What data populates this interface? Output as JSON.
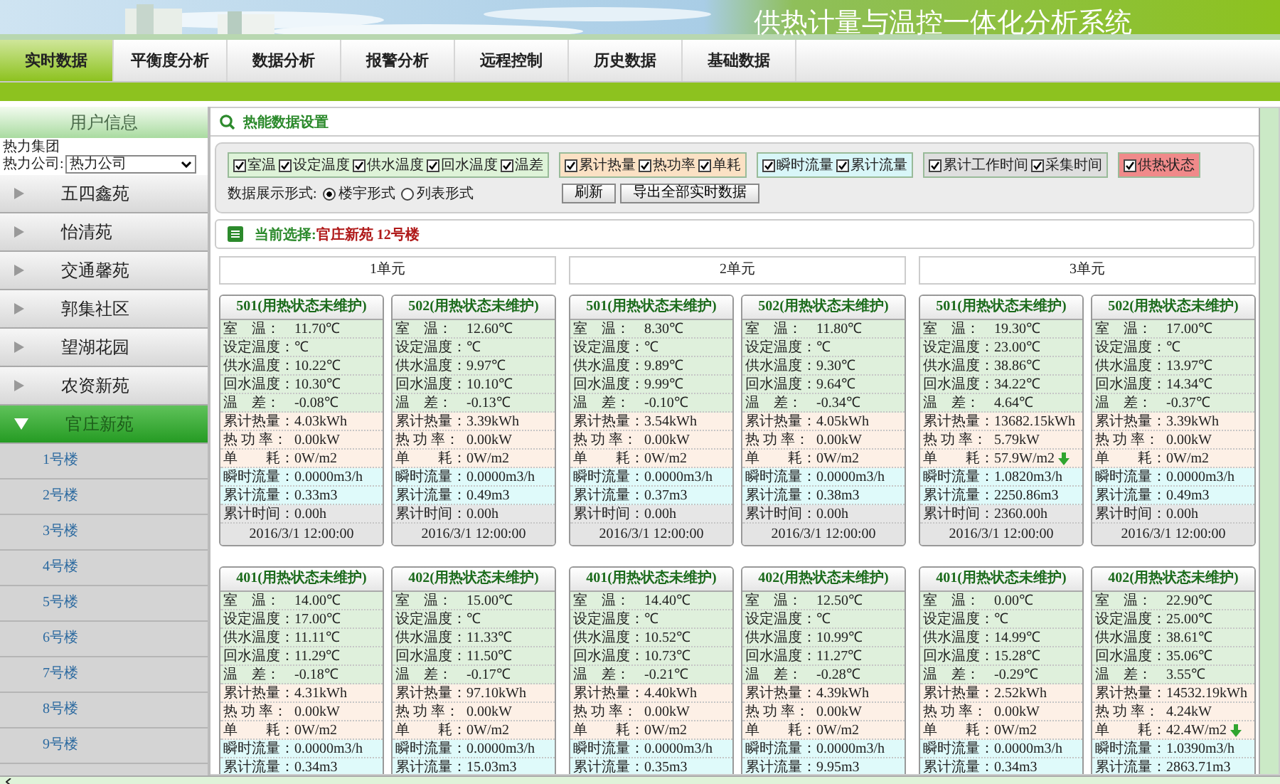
{
  "header": {
    "title": "供热计量与温控一体化分析系统"
  },
  "tabs": [
    {
      "label": "实时数据",
      "selected": true
    },
    {
      "label": "平衡度分析",
      "selected": false
    },
    {
      "label": "数据分析",
      "selected": false
    },
    {
      "label": "报警分析",
      "selected": false
    },
    {
      "label": "远程控制",
      "selected": false
    },
    {
      "label": "历史数据",
      "selected": false
    },
    {
      "label": "基础数据",
      "selected": false
    }
  ],
  "sidebar": {
    "title": "用户信息",
    "group": "热力集团",
    "company_label": "热力公司:",
    "company_value": "热力公司",
    "items": [
      {
        "label": "五四鑫苑",
        "expanded": false,
        "selected": false
      },
      {
        "label": "怡清苑",
        "expanded": false,
        "selected": false
      },
      {
        "label": "交通馨苑",
        "expanded": false,
        "selected": false
      },
      {
        "label": "郭集社区",
        "expanded": false,
        "selected": false
      },
      {
        "label": "望湖花园",
        "expanded": false,
        "selected": false
      },
      {
        "label": "农资新苑",
        "expanded": false,
        "selected": false
      },
      {
        "label": "官庄新苑",
        "expanded": true,
        "selected": true,
        "children": [
          {
            "label": "1号楼",
            "selected": false
          },
          {
            "label": "2号楼",
            "selected": false
          },
          {
            "label": "3号楼",
            "selected": false
          },
          {
            "label": "4号楼",
            "selected": false
          },
          {
            "label": "5号楼",
            "selected": false
          },
          {
            "label": "6号楼",
            "selected": false
          },
          {
            "label": "7号楼",
            "selected": false
          },
          {
            "label": "8号楼",
            "selected": false
          },
          {
            "label": "9号楼",
            "selected": false
          }
        ]
      }
    ]
  },
  "settings": {
    "title": "热能数据设置",
    "groups": [
      {
        "color": "#def3d8",
        "items": [
          {
            "label": "室温",
            "checked": true
          },
          {
            "label": "设定温度",
            "checked": true
          },
          {
            "label": "供水温度",
            "checked": true
          },
          {
            "label": "回水温度",
            "checked": true
          },
          {
            "label": "温差",
            "checked": true
          }
        ]
      },
      {
        "color": "#fbe1c4",
        "items": [
          {
            "label": "累计热量",
            "checked": true
          },
          {
            "label": "热功率",
            "checked": true
          },
          {
            "label": "单耗",
            "checked": true
          }
        ]
      },
      {
        "color": "#d8f6f8",
        "items": [
          {
            "label": "瞬时流量",
            "checked": true
          },
          {
            "label": "累计流量",
            "checked": true
          }
        ]
      },
      {
        "color": "#dedede",
        "items": [
          {
            "label": "累计工作时间",
            "checked": true
          },
          {
            "label": "采集时间",
            "checked": true
          }
        ]
      },
      {
        "color": "#f08a8a",
        "items": [
          {
            "label": "供热状态",
            "checked": true
          }
        ]
      }
    ],
    "display_label": "数据展示形式:",
    "display_options": [
      {
        "label": "楼宇形式",
        "selected": true
      },
      {
        "label": "列表形式",
        "selected": false
      }
    ],
    "buttons": [
      "刷新",
      "导出全部实时数据"
    ]
  },
  "current": {
    "label": "当前选择:",
    "value": "官庄新苑 12号楼"
  },
  "units": [
    {
      "title": "1单元",
      "cards": [
        {
          "title": "501(用热状态未维护)",
          "time": "2016/3/1 12:00:00",
          "rows": [
            {
              "label": "室　温：",
              "value": "11.70℃",
              "kind": "temp"
            },
            {
              "label": "设定温度：",
              "value": "℃",
              "kind": "temp"
            },
            {
              "label": "供水温度：",
              "value": "10.22℃",
              "kind": "temp"
            },
            {
              "label": "回水温度：",
              "value": "10.30℃",
              "kind": "temp"
            },
            {
              "label": "温　差：",
              "value": "-0.08℃",
              "kind": "temp"
            },
            {
              "label": "累计热量：",
              "value": "4.03kWh",
              "kind": "heat"
            },
            {
              "label": "热 功 率：",
              "value": "0.00kW",
              "kind": "heat"
            },
            {
              "label": "单　　耗：",
              "value": "0W/m2",
              "kind": "heat"
            },
            {
              "label": "瞬时流量：",
              "value": "0.0000m3/h",
              "kind": "flow"
            },
            {
              "label": "累计流量：",
              "value": "0.33m3",
              "kind": "flow"
            },
            {
              "label": "累计时间：",
              "value": "0.00h",
              "kind": "time"
            }
          ]
        },
        {
          "title": "502(用热状态未维护)",
          "time": "2016/3/1 12:00:00",
          "rows": [
            {
              "label": "室　温：",
              "value": "12.60℃",
              "kind": "temp"
            },
            {
              "label": "设定温度：",
              "value": "℃",
              "kind": "temp"
            },
            {
              "label": "供水温度：",
              "value": "9.97℃",
              "kind": "temp"
            },
            {
              "label": "回水温度：",
              "value": "10.10℃",
              "kind": "temp"
            },
            {
              "label": "温　差：",
              "value": "-0.13℃",
              "kind": "temp"
            },
            {
              "label": "累计热量：",
              "value": "3.39kWh",
              "kind": "heat"
            },
            {
              "label": "热 功 率：",
              "value": "0.00kW",
              "kind": "heat"
            },
            {
              "label": "单　　耗：",
              "value": "0W/m2",
              "kind": "heat"
            },
            {
              "label": "瞬时流量：",
              "value": "0.0000m3/h",
              "kind": "flow"
            },
            {
              "label": "累计流量：",
              "value": "0.49m3",
              "kind": "flow"
            },
            {
              "label": "累计时间：",
              "value": "0.00h",
              "kind": "time"
            }
          ]
        },
        {
          "title": "401(用热状态未维护)",
          "rows": [
            {
              "label": "室　温：",
              "value": "14.00℃",
              "kind": "temp"
            },
            {
              "label": "设定温度：",
              "value": "17.00℃",
              "kind": "temp"
            },
            {
              "label": "供水温度：",
              "value": "11.11℃",
              "kind": "temp"
            },
            {
              "label": "回水温度：",
              "value": "11.29℃",
              "kind": "temp"
            },
            {
              "label": "温　差：",
              "value": "-0.18℃",
              "kind": "temp"
            },
            {
              "label": "累计热量：",
              "value": "4.31kWh",
              "kind": "heat"
            },
            {
              "label": "热 功 率：",
              "value": "0.00kW",
              "kind": "heat"
            },
            {
              "label": "单　　耗：",
              "value": "0W/m2",
              "kind": "heat"
            },
            {
              "label": "瞬时流量：",
              "value": "0.0000m3/h",
              "kind": "flow"
            },
            {
              "label": "累计流量：",
              "value": "0.34m3",
              "kind": "flow"
            }
          ]
        },
        {
          "title": "402(用热状态未维护)",
          "rows": [
            {
              "label": "室　温：",
              "value": "15.00℃",
              "kind": "temp"
            },
            {
              "label": "设定温度：",
              "value": "℃",
              "kind": "temp"
            },
            {
              "label": "供水温度：",
              "value": "11.33℃",
              "kind": "temp"
            },
            {
              "label": "回水温度：",
              "value": "11.50℃",
              "kind": "temp"
            },
            {
              "label": "温　差：",
              "value": "-0.17℃",
              "kind": "temp"
            },
            {
              "label": "累计热量：",
              "value": "97.10kWh",
              "kind": "heat"
            },
            {
              "label": "热 功 率：",
              "value": "0.00kW",
              "kind": "heat"
            },
            {
              "label": "单　　耗：",
              "value": "0W/m2",
              "kind": "heat"
            },
            {
              "label": "瞬时流量：",
              "value": "0.0000m3/h",
              "kind": "flow"
            },
            {
              "label": "累计流量：",
              "value": "15.03m3",
              "kind": "flow"
            }
          ]
        }
      ]
    },
    {
      "title": "2单元",
      "cards": [
        {
          "title": "501(用热状态未维护)",
          "time": "2016/3/1 12:00:00",
          "rows": [
            {
              "label": "室　温：",
              "value": "8.30℃",
              "kind": "temp"
            },
            {
              "label": "设定温度：",
              "value": "℃",
              "kind": "temp"
            },
            {
              "label": "供水温度：",
              "value": "9.89℃",
              "kind": "temp"
            },
            {
              "label": "回水温度：",
              "value": "9.99℃",
              "kind": "temp"
            },
            {
              "label": "温　差：",
              "value": "-0.10℃",
              "kind": "temp"
            },
            {
              "label": "累计热量：",
              "value": "3.54kWh",
              "kind": "heat"
            },
            {
              "label": "热 功 率：",
              "value": "0.00kW",
              "kind": "heat"
            },
            {
              "label": "单　　耗：",
              "value": "0W/m2",
              "kind": "heat"
            },
            {
              "label": "瞬时流量：",
              "value": "0.0000m3/h",
              "kind": "flow"
            },
            {
              "label": "累计流量：",
              "value": "0.37m3",
              "kind": "flow"
            },
            {
              "label": "累计时间：",
              "value": "0.00h",
              "kind": "time"
            }
          ]
        },
        {
          "title": "502(用热状态未维护)",
          "time": "2016/3/1 12:00:00",
          "rows": [
            {
              "label": "室　温：",
              "value": "11.80℃",
              "kind": "temp"
            },
            {
              "label": "设定温度：",
              "value": "℃",
              "kind": "temp"
            },
            {
              "label": "供水温度：",
              "value": "9.30℃",
              "kind": "temp"
            },
            {
              "label": "回水温度：",
              "value": "9.64℃",
              "kind": "temp"
            },
            {
              "label": "温　差：",
              "value": "-0.34℃",
              "kind": "temp"
            },
            {
              "label": "累计热量：",
              "value": "4.05kWh",
              "kind": "heat"
            },
            {
              "label": "热 功 率：",
              "value": "0.00kW",
              "kind": "heat"
            },
            {
              "label": "单　　耗：",
              "value": "0W/m2",
              "kind": "heat"
            },
            {
              "label": "瞬时流量：",
              "value": "0.0000m3/h",
              "kind": "flow"
            },
            {
              "label": "累计流量：",
              "value": "0.38m3",
              "kind": "flow"
            },
            {
              "label": "累计时间：",
              "value": "0.00h",
              "kind": "time"
            }
          ]
        },
        {
          "title": "401(用热状态未维护)",
          "rows": [
            {
              "label": "室　温：",
              "value": "14.40℃",
              "kind": "temp"
            },
            {
              "label": "设定温度：",
              "value": "℃",
              "kind": "temp"
            },
            {
              "label": "供水温度：",
              "value": "10.52℃",
              "kind": "temp"
            },
            {
              "label": "回水温度：",
              "value": "10.73℃",
              "kind": "temp"
            },
            {
              "label": "温　差：",
              "value": "-0.21℃",
              "kind": "temp"
            },
            {
              "label": "累计热量：",
              "value": "4.40kWh",
              "kind": "heat"
            },
            {
              "label": "热 功 率：",
              "value": "0.00kW",
              "kind": "heat"
            },
            {
              "label": "单　　耗：",
              "value": "0W/m2",
              "kind": "heat"
            },
            {
              "label": "瞬时流量：",
              "value": "0.0000m3/h",
              "kind": "flow"
            },
            {
              "label": "累计流量：",
              "value": "0.35m3",
              "kind": "flow"
            }
          ]
        },
        {
          "title": "402(用热状态未维护)",
          "rows": [
            {
              "label": "室　温：",
              "value": "12.50℃",
              "kind": "temp"
            },
            {
              "label": "设定温度：",
              "value": "℃",
              "kind": "temp"
            },
            {
              "label": "供水温度：",
              "value": "10.99℃",
              "kind": "temp"
            },
            {
              "label": "回水温度：",
              "value": "11.27℃",
              "kind": "temp"
            },
            {
              "label": "温　差：",
              "value": "-0.28℃",
              "kind": "temp"
            },
            {
              "label": "累计热量：",
              "value": "4.39kWh",
              "kind": "heat"
            },
            {
              "label": "热 功 率：",
              "value": "0.00kW",
              "kind": "heat"
            },
            {
              "label": "单　　耗：",
              "value": "0W/m2",
              "kind": "heat"
            },
            {
              "label": "瞬时流量：",
              "value": "0.0000m3/h",
              "kind": "flow"
            },
            {
              "label": "累计流量：",
              "value": "9.95m3",
              "kind": "flow"
            }
          ]
        }
      ]
    },
    {
      "title": "3单元",
      "cards": [
        {
          "title": "501(用热状态未维护)",
          "time": "2016/3/1 12:00:00",
          "rows": [
            {
              "label": "室　温：",
              "value": "19.30℃",
              "kind": "temp"
            },
            {
              "label": "设定温度：",
              "value": "23.00℃",
              "kind": "temp"
            },
            {
              "label": "供水温度：",
              "value": "38.86℃",
              "kind": "temp"
            },
            {
              "label": "回水温度：",
              "value": "34.22℃",
              "kind": "temp"
            },
            {
              "label": "温　差：",
              "value": "4.64℃",
              "kind": "temp"
            },
            {
              "label": "累计热量：",
              "value": "13682.15kWh",
              "kind": "heat"
            },
            {
              "label": "热 功 率：",
              "value": "5.79kW",
              "kind": "heat"
            },
            {
              "label": "单　　耗：",
              "value": "57.9W/m2",
              "kind": "heat",
              "falling": true
            },
            {
              "label": "瞬时流量：",
              "value": "1.0820m3/h",
              "kind": "flow"
            },
            {
              "label": "累计流量：",
              "value": "2250.86m3",
              "kind": "flow"
            },
            {
              "label": "累计时间：",
              "value": "2360.00h",
              "kind": "time"
            }
          ]
        },
        {
          "title": "502(用热状态未维护)",
          "time": "2016/3/1 12:00:00",
          "rows": [
            {
              "label": "室　温：",
              "value": "17.00℃",
              "kind": "temp"
            },
            {
              "label": "设定温度：",
              "value": "℃",
              "kind": "temp"
            },
            {
              "label": "供水温度：",
              "value": "13.97℃",
              "kind": "temp"
            },
            {
              "label": "回水温度：",
              "value": "14.34℃",
              "kind": "temp"
            },
            {
              "label": "温　差：",
              "value": "-0.37℃",
              "kind": "temp"
            },
            {
              "label": "累计热量：",
              "value": "3.39kWh",
              "kind": "heat"
            },
            {
              "label": "热 功 率：",
              "value": "0.00kW",
              "kind": "heat"
            },
            {
              "label": "单　　耗：",
              "value": "0W/m2",
              "kind": "heat"
            },
            {
              "label": "瞬时流量：",
              "value": "0.0000m3/h",
              "kind": "flow"
            },
            {
              "label": "累计流量：",
              "value": "0.49m3",
              "kind": "flow"
            },
            {
              "label": "累计时间：",
              "value": "0.00h",
              "kind": "time"
            }
          ]
        },
        {
          "title": "401(用热状态未维护)",
          "rows": [
            {
              "label": "室　温：",
              "value": "0.00℃",
              "kind": "temp"
            },
            {
              "label": "设定温度：",
              "value": "℃",
              "kind": "temp"
            },
            {
              "label": "供水温度：",
              "value": "14.99℃",
              "kind": "temp"
            },
            {
              "label": "回水温度：",
              "value": "15.28℃",
              "kind": "temp"
            },
            {
              "label": "温　差：",
              "value": "-0.29℃",
              "kind": "temp"
            },
            {
              "label": "累计热量：",
              "value": "2.52kWh",
              "kind": "heat"
            },
            {
              "label": "热 功 率：",
              "value": "0.00kW",
              "kind": "heat"
            },
            {
              "label": "单　　耗：",
              "value": "0W/m2",
              "kind": "heat"
            },
            {
              "label": "瞬时流量：",
              "value": "0.0000m3/h",
              "kind": "flow"
            },
            {
              "label": "累计流量：",
              "value": "0.34m3",
              "kind": "flow"
            }
          ]
        },
        {
          "title": "402(用热状态未维护)",
          "rows": [
            {
              "label": "室　温：",
              "value": "22.90℃",
              "kind": "temp"
            },
            {
              "label": "设定温度：",
              "value": "25.00℃",
              "kind": "temp"
            },
            {
              "label": "供水温度：",
              "value": "38.61℃",
              "kind": "temp"
            },
            {
              "label": "回水温度：",
              "value": "35.06℃",
              "kind": "temp"
            },
            {
              "label": "温　差：",
              "value": "3.55℃",
              "kind": "temp"
            },
            {
              "label": "累计热量：",
              "value": "14532.19kWh",
              "kind": "heat"
            },
            {
              "label": "热 功 率：",
              "value": "4.24kW",
              "kind": "heat"
            },
            {
              "label": "单　　耗：",
              "value": "42.4W/m2",
              "kind": "heat",
              "falling": true
            },
            {
              "label": "瞬时流量：",
              "value": "1.0390m3/h",
              "kind": "flow"
            },
            {
              "label": "累计流量：",
              "value": "2863.71m3",
              "kind": "flow"
            }
          ]
        }
      ]
    }
  ]
}
